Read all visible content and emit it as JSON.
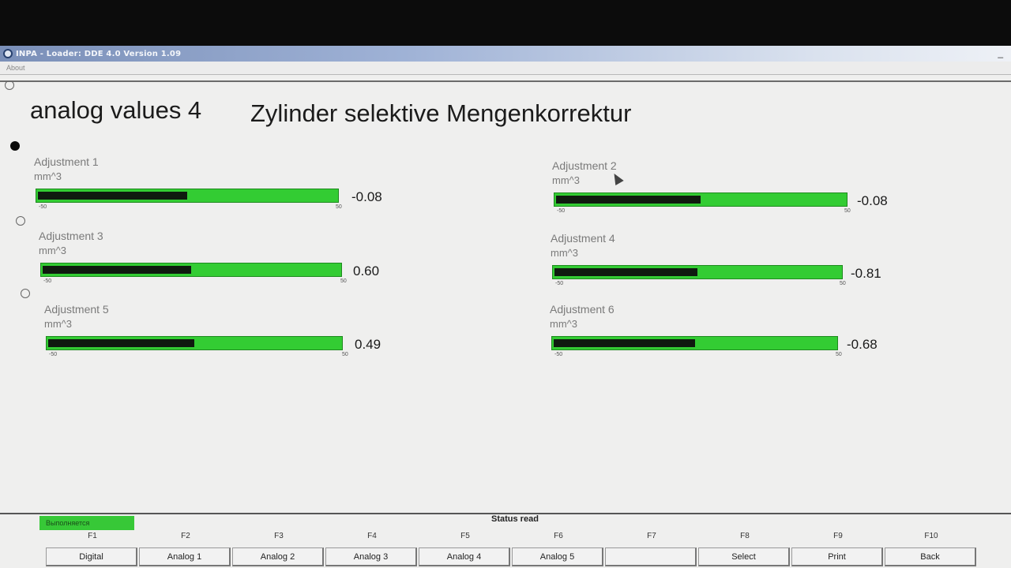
{
  "window": {
    "title": "INPA - Loader: DDE 4.0 Version 1.09",
    "menu": [
      "About"
    ]
  },
  "header": {
    "left": "analog values 4",
    "right": "Zylinder selektive Mengenkorrektur"
  },
  "gauges": [
    {
      "label": "Adjustment 1",
      "unit": "mm^3",
      "min": "-50",
      "max": "50",
      "value": "-0.08",
      "fill_fraction": 0.5
    },
    {
      "label": "Adjustment 2",
      "unit": "mm^3",
      "min": "-50",
      "max": "50",
      "value": "-0.08",
      "fill_fraction": 0.5
    },
    {
      "label": "Adjustment 3",
      "unit": "mm^3",
      "min": "-50",
      "max": "50",
      "value": "0.60",
      "fill_fraction": 0.5
    },
    {
      "label": "Adjustment 4",
      "unit": "mm^3",
      "min": "-50",
      "max": "50",
      "value": "-0.81",
      "fill_fraction": 0.5
    },
    {
      "label": "Adjustment 5",
      "unit": "mm^3",
      "min": "-50",
      "max": "50",
      "value": "0.49",
      "fill_fraction": 0.5
    },
    {
      "label": "Adjustment 6",
      "unit": "mm^3",
      "min": "-50",
      "max": "50",
      "value": "-0.68",
      "fill_fraction": 0.5
    }
  ],
  "status": {
    "indicator": "Выполняется",
    "text": "Status read"
  },
  "fkeys": [
    {
      "key": "F1",
      "label": "Digital"
    },
    {
      "key": "F2",
      "label": "Analog 1"
    },
    {
      "key": "F3",
      "label": "Analog 2"
    },
    {
      "key": "F4",
      "label": "Analog 3"
    },
    {
      "key": "F5",
      "label": "Analog 4"
    },
    {
      "key": "F6",
      "label": "Analog 5"
    },
    {
      "key": "F7",
      "label": ""
    },
    {
      "key": "F8",
      "label": "Select"
    },
    {
      "key": "F9",
      "label": "Print"
    },
    {
      "key": "F10",
      "label": "Back"
    }
  ],
  "colors": {
    "bar_green": "#33cc33",
    "bar_fill": "#0f1a0f",
    "status_green": "#37c837"
  }
}
